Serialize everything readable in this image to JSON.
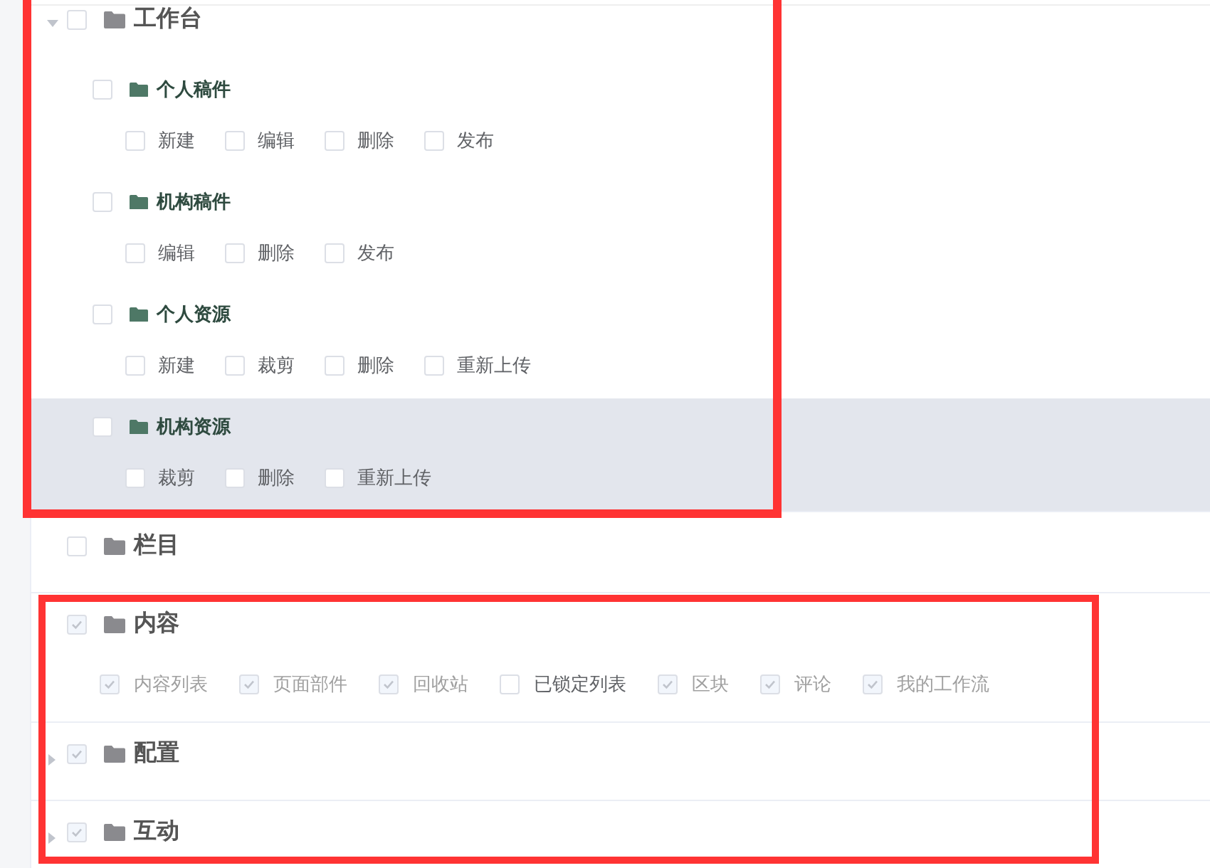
{
  "tree": [
    {
      "label": "工作台",
      "expanded": true,
      "checked": false,
      "disabled": false,
      "groups": [
        {
          "label": "个人稿件",
          "checked": false,
          "highlighted": false,
          "permissions": [
            {
              "label": "新建",
              "checked": false,
              "disabled": false
            },
            {
              "label": "编辑",
              "checked": false,
              "disabled": false
            },
            {
              "label": "删除",
              "checked": false,
              "disabled": false
            },
            {
              "label": "发布",
              "checked": false,
              "disabled": false
            }
          ]
        },
        {
          "label": "机构稿件",
          "checked": false,
          "highlighted": false,
          "permissions": [
            {
              "label": "编辑",
              "checked": false,
              "disabled": false
            },
            {
              "label": "删除",
              "checked": false,
              "disabled": false
            },
            {
              "label": "发布",
              "checked": false,
              "disabled": false
            }
          ]
        },
        {
          "label": "个人资源",
          "checked": false,
          "highlighted": false,
          "permissions": [
            {
              "label": "新建",
              "checked": false,
              "disabled": false
            },
            {
              "label": "裁剪",
              "checked": false,
              "disabled": false
            },
            {
              "label": "删除",
              "checked": false,
              "disabled": false
            },
            {
              "label": "重新上传",
              "checked": false,
              "disabled": false
            }
          ]
        },
        {
          "label": "机构资源",
          "checked": false,
          "highlighted": true,
          "permissions": [
            {
              "label": "裁剪",
              "checked": false,
              "disabled": false
            },
            {
              "label": "删除",
              "checked": false,
              "disabled": false
            },
            {
              "label": "重新上传",
              "checked": false,
              "disabled": false
            }
          ]
        }
      ]
    },
    {
      "label": "栏目",
      "checked": false,
      "disabled": false
    },
    {
      "label": "内容",
      "checked": true,
      "disabled": true,
      "permissions": [
        {
          "label": "内容列表",
          "checked": true,
          "disabled": true
        },
        {
          "label": "页面部件",
          "checked": true,
          "disabled": true
        },
        {
          "label": "回收站",
          "checked": true,
          "disabled": true
        },
        {
          "label": "已锁定列表",
          "checked": false,
          "disabled": false
        },
        {
          "label": "区块",
          "checked": true,
          "disabled": true
        },
        {
          "label": "评论",
          "checked": true,
          "disabled": true
        },
        {
          "label": "我的工作流",
          "checked": true,
          "disabled": true
        }
      ]
    },
    {
      "label": "配置",
      "expanded": false,
      "checked": true,
      "disabled": true
    },
    {
      "label": "互动",
      "expanded": false,
      "checked": true,
      "disabled": true
    }
  ]
}
